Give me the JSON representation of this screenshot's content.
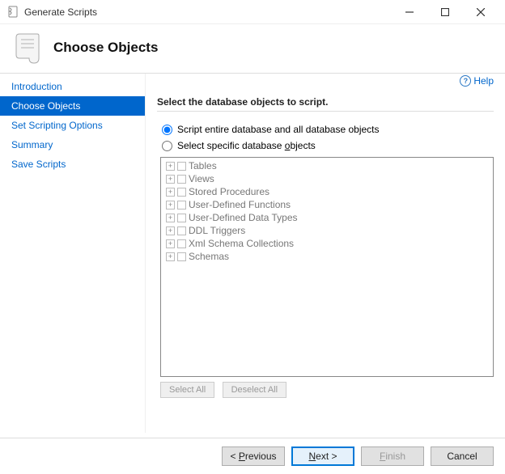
{
  "window": {
    "title": "Generate Scripts"
  },
  "header": {
    "heading": "Choose Objects"
  },
  "help": {
    "label": "Help"
  },
  "sidebar": {
    "items": [
      {
        "label": "Introduction",
        "selected": false
      },
      {
        "label": "Choose Objects",
        "selected": true
      },
      {
        "label": "Set Scripting Options",
        "selected": false
      },
      {
        "label": "Summary",
        "selected": false
      },
      {
        "label": "Save Scripts",
        "selected": false
      }
    ]
  },
  "main": {
    "instruction": "Select the database objects to script.",
    "radios": {
      "entire": "Script entire database and all database objects",
      "specific_prefix": "Select specific database ",
      "specific_u": "o",
      "specific_suffix": "bjects",
      "selected": "entire"
    },
    "tree": [
      "Tables",
      "Views",
      "Stored Procedures",
      "User-Defined Functions",
      "User-Defined Data Types",
      "DDL Triggers",
      "Xml Schema Collections",
      "Schemas"
    ],
    "select_all": "Select All",
    "deselect_all": "Deselect All"
  },
  "footer": {
    "prev_prefix": "< ",
    "prev_u": "P",
    "prev_suffix": "revious",
    "next_u": "N",
    "next_suffix": "ext >",
    "finish_u": "F",
    "finish_suffix": "inish",
    "cancel": "Cancel"
  }
}
